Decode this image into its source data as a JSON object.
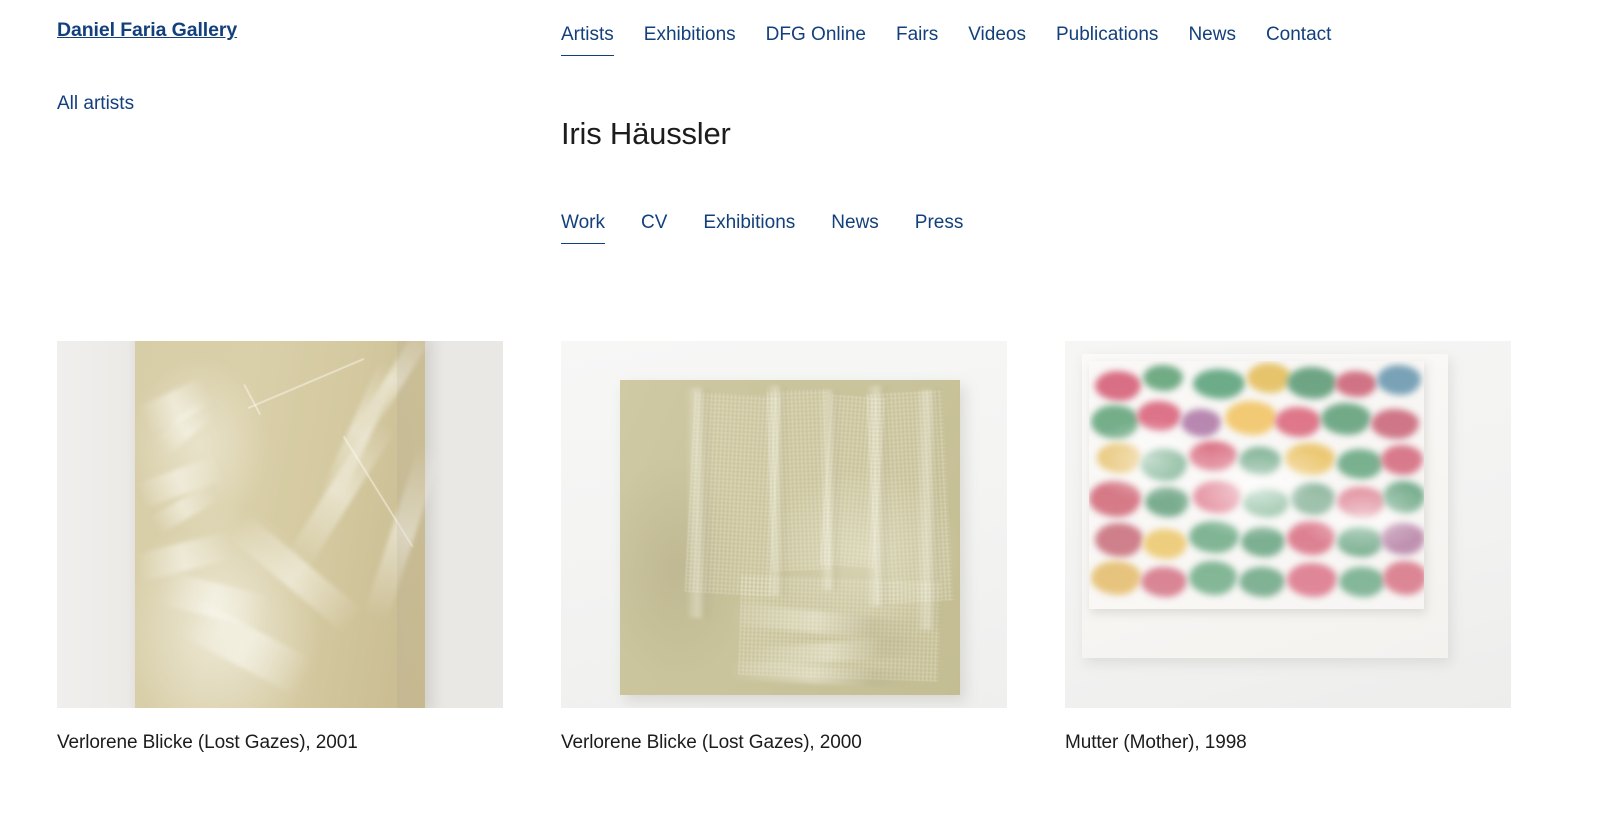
{
  "header": {
    "logo": "Daniel Faria Gallery",
    "nav": [
      {
        "label": "Artists",
        "active": true,
        "name": "nav-item-artists"
      },
      {
        "label": "Exhibitions",
        "active": false,
        "name": "nav-item-exhibitions"
      },
      {
        "label": "DFG Online",
        "active": false,
        "name": "nav-item-dfg-online"
      },
      {
        "label": "Fairs",
        "active": false,
        "name": "nav-item-fairs"
      },
      {
        "label": "Videos",
        "active": false,
        "name": "nav-item-videos"
      },
      {
        "label": "Publications",
        "active": false,
        "name": "nav-item-publications"
      },
      {
        "label": "News",
        "active": false,
        "name": "nav-item-news"
      },
      {
        "label": "Contact",
        "active": false,
        "name": "nav-item-contact"
      }
    ]
  },
  "sidebar": {
    "all_artists_label": "All artists"
  },
  "artist": {
    "name": "Iris Häussler",
    "tabs": [
      {
        "label": "Work",
        "active": true,
        "name": "artist-tab-work"
      },
      {
        "label": "CV",
        "active": false,
        "name": "artist-tab-cv"
      },
      {
        "label": "Exhibitions",
        "active": false,
        "name": "artist-tab-exhibitions"
      },
      {
        "label": "News",
        "active": false,
        "name": "artist-tab-news"
      },
      {
        "label": "Press",
        "active": false,
        "name": "artist-tab-press"
      }
    ]
  },
  "works": [
    {
      "caption": "Verlorene Blicke (Lost Gazes), 2001",
      "title": "Verlorene Blicke (Lost Gazes)",
      "year": "2001",
      "artwork_description": "Tall vertical beige-tan wax panel with translucent folded fabric embedded, mounted on a pale grey wall"
    },
    {
      "caption": "Verlorene Blicke (Lost Gazes), 2000",
      "title": "Verlorene Blicke (Lost Gazes)",
      "year": "2000",
      "artwork_description": "Landscape olive-beige wax panel with embedded woven textile and draped folds, on a white wall"
    },
    {
      "caption": "Mutter (Mother), 1998",
      "title": "Mutter (Mother)",
      "year": "1998",
      "artwork_description": "Milky white wax panel with red, green and yellow flowers embedded beneath the surface, on white backing board"
    }
  ],
  "colors": {
    "navy": "#13407c",
    "text": "#1c1c1c",
    "background": "#ffffff"
  }
}
